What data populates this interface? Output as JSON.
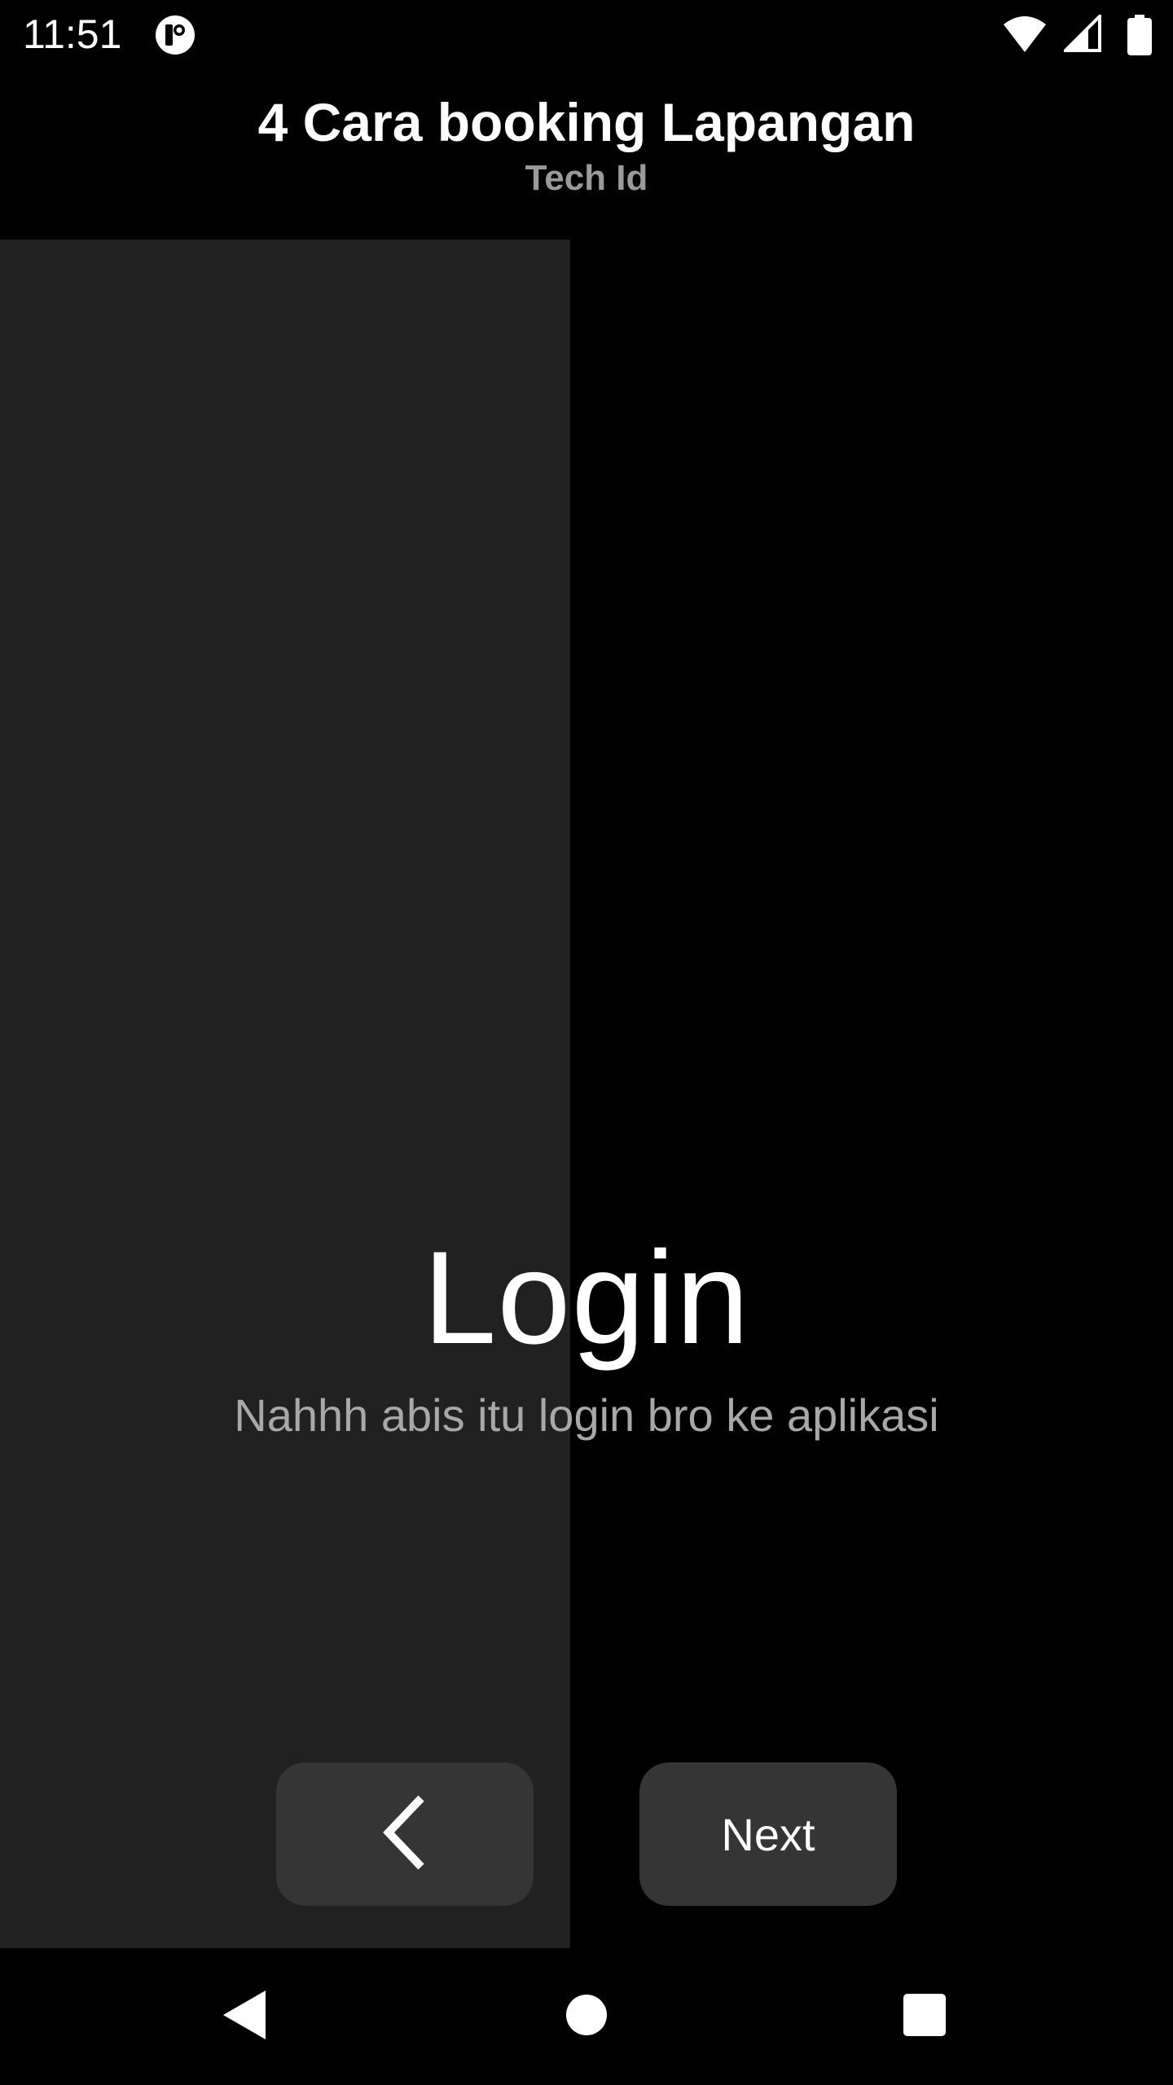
{
  "status_bar": {
    "time": "11:51",
    "app_icon": "notification-app-icon",
    "wifi_icon": "wifi-icon",
    "signal_icon": "cell-signal-icon",
    "battery_icon": "battery-icon"
  },
  "header": {
    "title": "4 Cara booking Lapangan",
    "subtitle": "Tech Id"
  },
  "slide": {
    "title": "Login",
    "description": "Nahhh abis itu login bro ke aplikasi",
    "progress_fraction": 0.486
  },
  "buttons": {
    "back_icon": "chevron-left-icon",
    "next_label": "Next"
  },
  "navigation": {
    "back_icon": "triangle-back-icon",
    "home_icon": "circle-home-icon",
    "recents_icon": "square-recents-icon"
  },
  "colors": {
    "background": "#000000",
    "progress_fill": "#212121",
    "button_bg": "#353535",
    "subtitle": "#9a9a9a",
    "description": "#a8a8a8"
  }
}
